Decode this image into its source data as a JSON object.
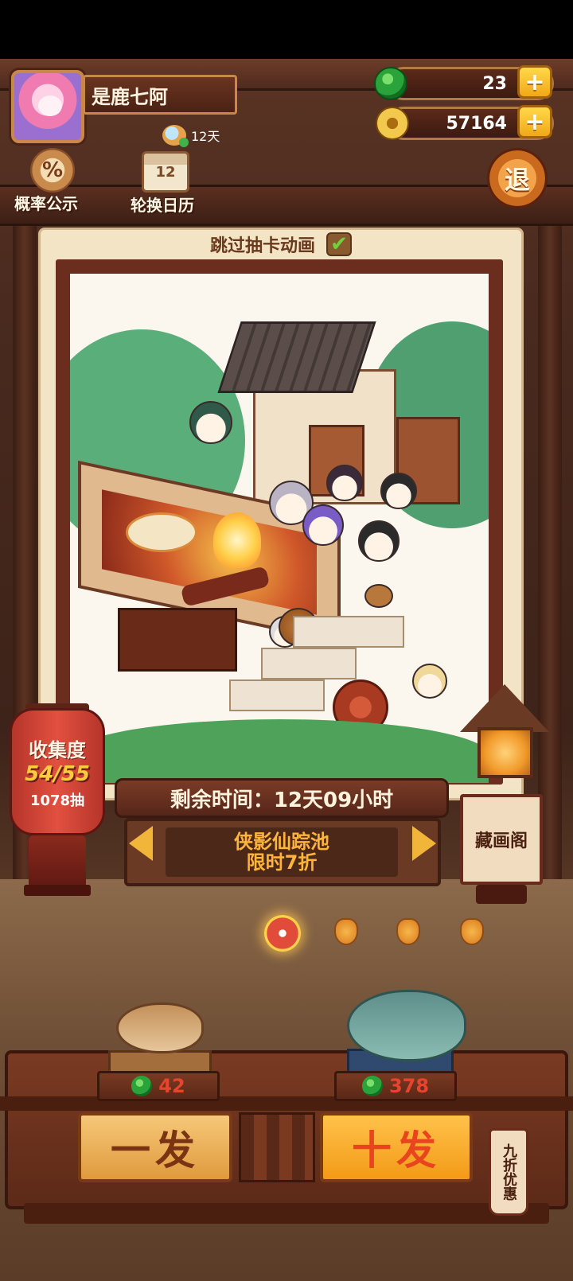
{
  "player": {
    "name": "是鹿七阿",
    "days_label": "12天"
  },
  "currency": {
    "jade": "23",
    "gold": "57164",
    "plus_symbol": "+"
  },
  "menu": {
    "probability_label": "概率公示",
    "probability_icon_glyph": "%",
    "calendar_label": "轮换日历",
    "calendar_icon_glyph": "12",
    "quit_label": "退"
  },
  "card": {
    "skip_label": "跳过抽卡动画",
    "skip_checked": true,
    "check_glyph": "✔"
  },
  "banner": {
    "time_label": "剩余时间：12天09小时",
    "pool_name": "侠影仙踪池",
    "pool_sub": "限时7折"
  },
  "collection": {
    "title": "收集度",
    "count": "54/55",
    "pulls": "1078抽"
  },
  "gallery": {
    "label": "藏画阁"
  },
  "pagination": {
    "total": 4,
    "active": 1
  },
  "draw": {
    "single_price": "42",
    "single_label": "一发",
    "ten_price": "378",
    "ten_label": "十发",
    "discount_label": "九折优惠"
  },
  "colors": {
    "accent_gold": "#ffcc3d",
    "price_red": "#e5452e",
    "pool_orange": "#ffb43a",
    "jade_green": "#2aa43a"
  }
}
